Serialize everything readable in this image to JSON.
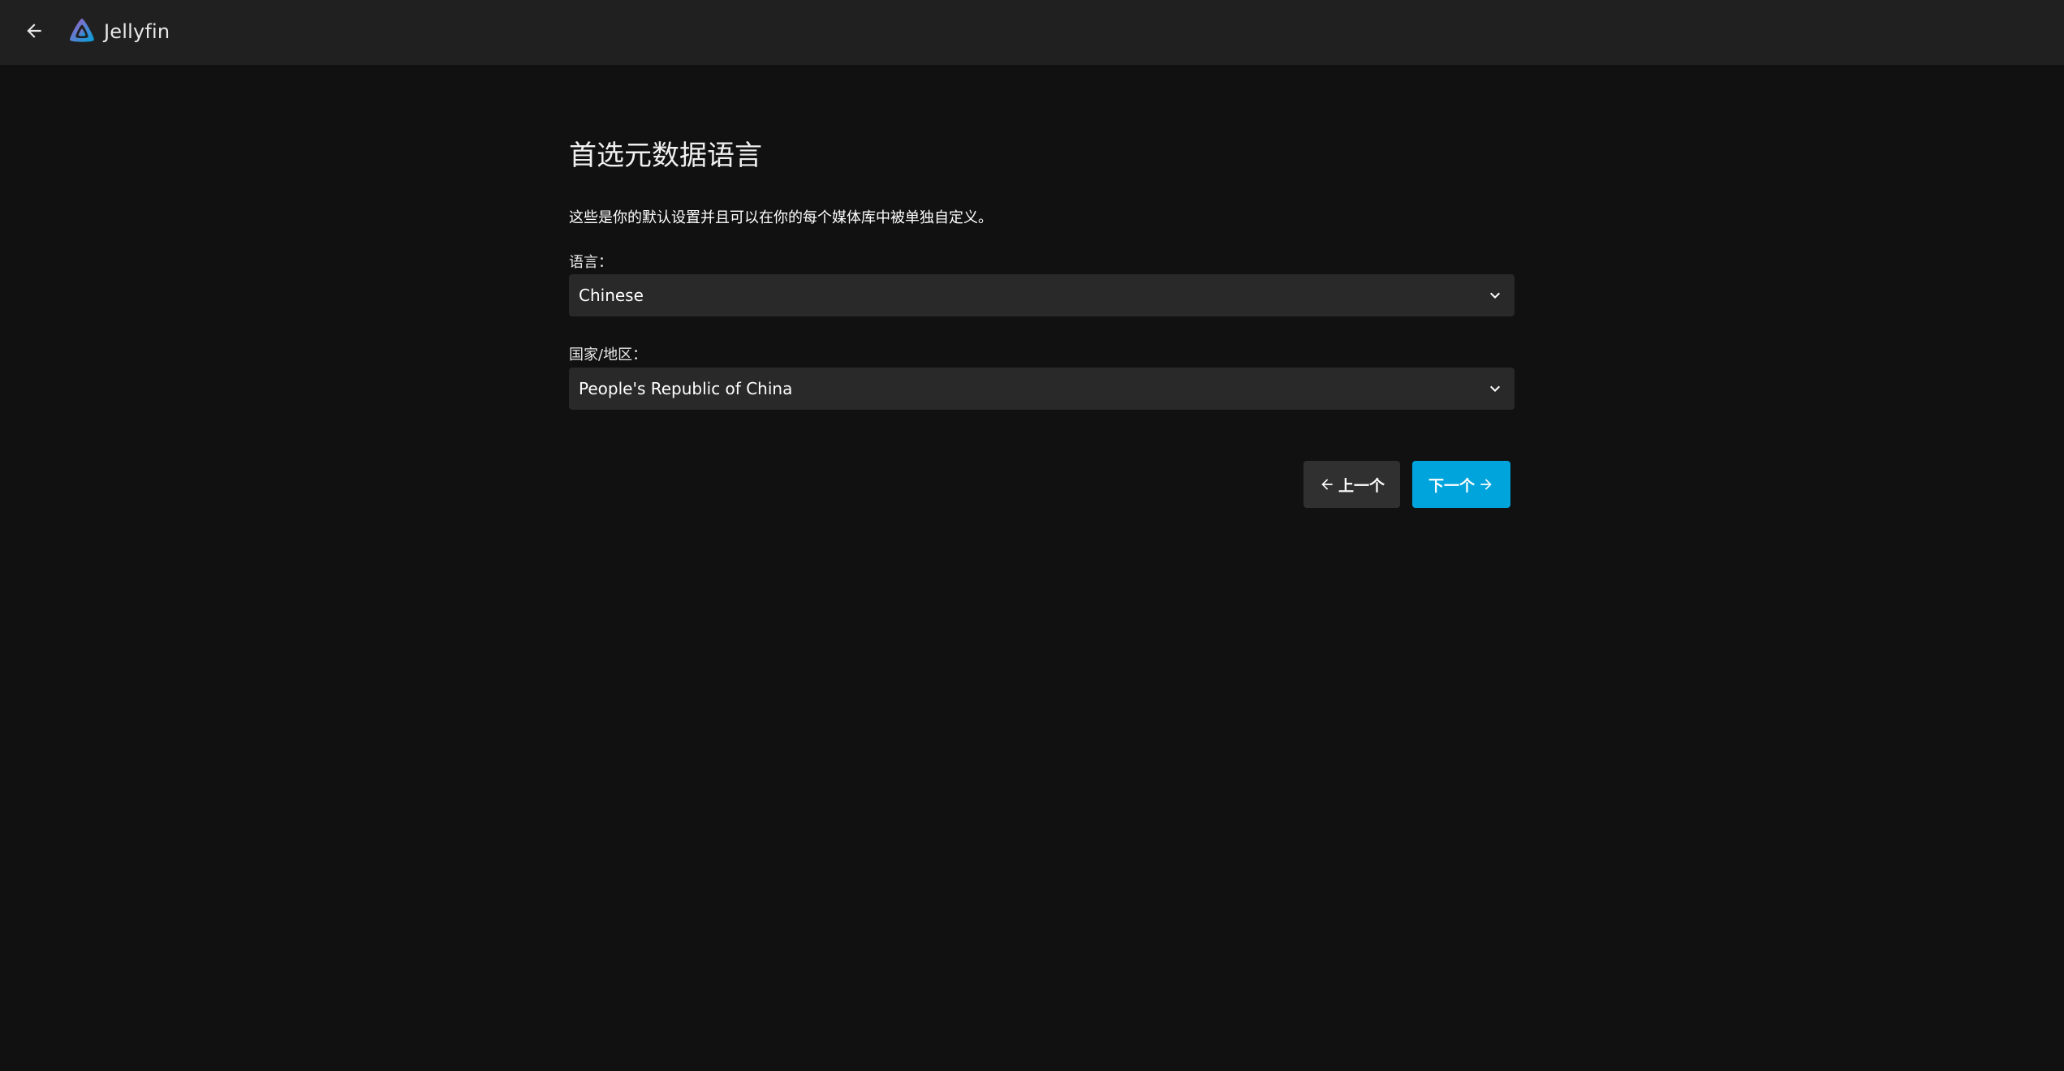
{
  "header": {
    "app_name": "Jellyfin",
    "back_icon": "arrow-left-icon",
    "logo_icon": "jellyfin-logo-icon"
  },
  "page": {
    "title": "首选元数据语言",
    "description": "这些是你的默认设置并且可以在你的每个媒体库中被单独自定义。"
  },
  "form": {
    "language_label": "语言：",
    "language_value": "Chinese",
    "country_label": "国家/地区：",
    "country_value": "People's Republic of China"
  },
  "buttons": {
    "previous_label": "上一个",
    "next_label": "下一个"
  },
  "colors": {
    "accent": "#00a4dc",
    "background": "#111111",
    "header": "#202020",
    "select_background": "#292929"
  }
}
